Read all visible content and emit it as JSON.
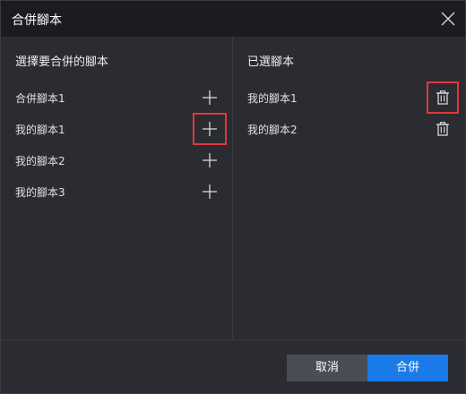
{
  "dialog": {
    "title": "合併腳本",
    "close_icon": "close-icon"
  },
  "left_panel": {
    "heading": "選擇要合併的腳本",
    "items": [
      {
        "label": "合併腳本1",
        "icon": "plus-icon"
      },
      {
        "label": "我的腳本1",
        "icon": "plus-icon",
        "highlighted": true
      },
      {
        "label": "我的腳本2",
        "icon": "plus-icon"
      },
      {
        "label": "我的腳本3",
        "icon": "plus-icon"
      }
    ]
  },
  "right_panel": {
    "heading": "已選腳本",
    "items": [
      {
        "label": "我的腳本1",
        "icon": "trash-icon",
        "highlighted": true
      },
      {
        "label": "我的腳本2",
        "icon": "trash-icon"
      }
    ]
  },
  "footer": {
    "cancel_label": "取消",
    "merge_label": "合併"
  },
  "colors": {
    "accent": "#1a7ae8",
    "highlight": "#e0393e",
    "background": "#2a2c32",
    "titlebar": "#1b1c20"
  }
}
